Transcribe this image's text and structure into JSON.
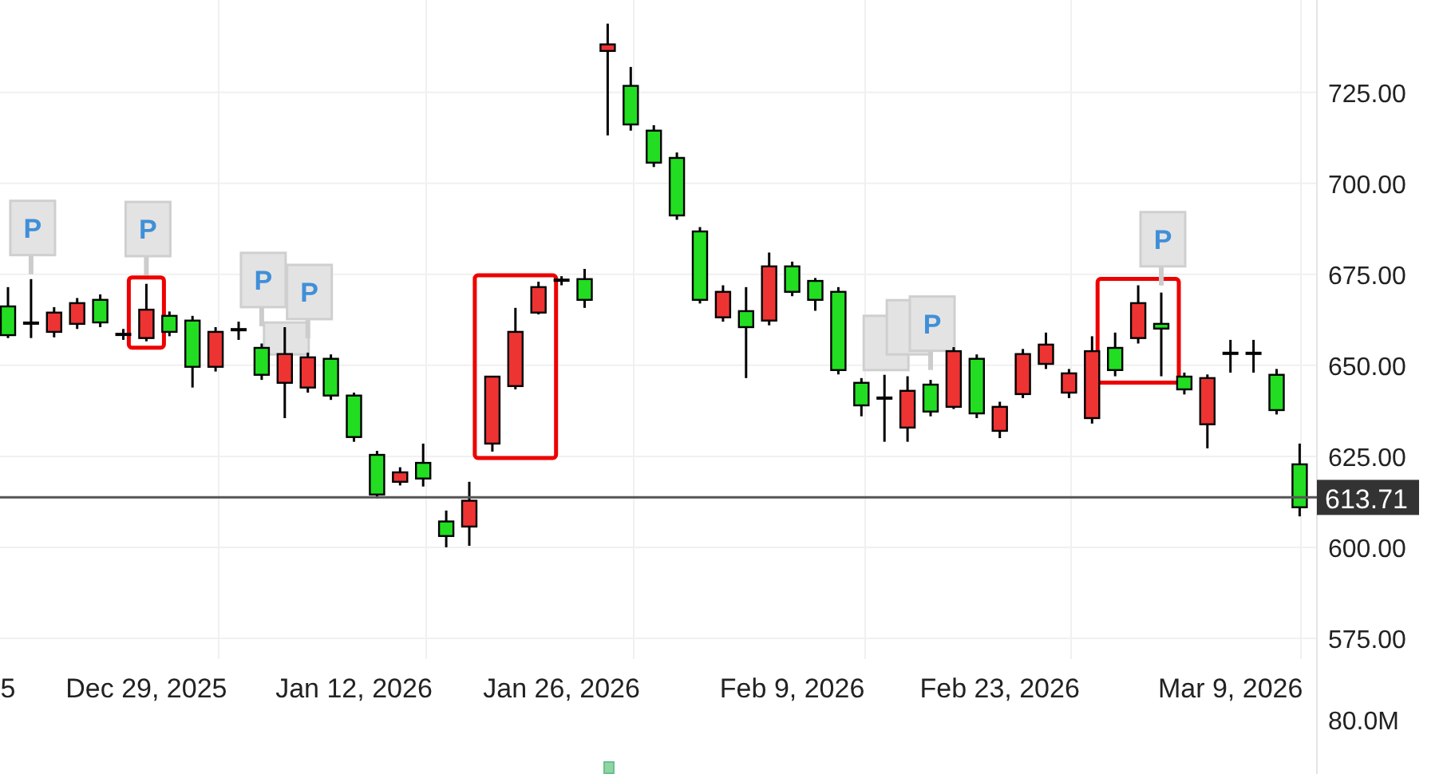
{
  "chart": {
    "chart_data": {
      "type": "candlestick",
      "categories": [
        "5",
        null,
        null,
        null,
        null,
        null,
        "Dec 29, 2025",
        null,
        null,
        null,
        null,
        null,
        null,
        null,
        null,
        "Jan 12, 2026",
        null,
        null,
        null,
        null,
        null,
        null,
        null,
        null,
        "Jan 26, 2026",
        null,
        null,
        null,
        null,
        null,
        null,
        null,
        null,
        null,
        "Feb 9, 2026",
        null,
        null,
        null,
        null,
        null,
        null,
        null,
        null,
        "Feb 23, 2026",
        null,
        null,
        null,
        null,
        null,
        null,
        null,
        null,
        null,
        "Mar 9, 2026",
        null,
        null,
        null
      ],
      "ohlc": [
        [
          658.3,
          671.5,
          657.5,
          666.2
        ],
        [
          661.4,
          673.7,
          657.5,
          661.6
        ],
        [
          664.5,
          666,
          657.7,
          659.2
        ],
        [
          667.1,
          668.5,
          660,
          661.4
        ],
        [
          661.8,
          669.5,
          660.5,
          668
        ],
        [
          658.3,
          660,
          657,
          658.5
        ],
        [
          665.3,
          672.4,
          656.6,
          657.5
        ],
        [
          659.2,
          664.8,
          658,
          663.6
        ],
        [
          649.6,
          663.6,
          643.9,
          662.3
        ],
        [
          659.2,
          660.5,
          648.3,
          649.6
        ],
        [
          659.6,
          662,
          657,
          659.8
        ],
        [
          647.4,
          656,
          646,
          654.8
        ],
        [
          653.1,
          660.5,
          635.5,
          645.2
        ],
        [
          652.2,
          653.5,
          642.5,
          643.9
        ],
        [
          641.7,
          653,
          640.5,
          651.8
        ],
        [
          630.3,
          642.5,
          629,
          641.7
        ],
        [
          614.5,
          626.5,
          613.5,
          625.4
        ],
        [
          620.6,
          622,
          617,
          618
        ],
        [
          618.9,
          628.5,
          616.7,
          623.2
        ],
        [
          603.1,
          610.1,
          600,
          607.1
        ],
        [
          612.8,
          618,
          600.4,
          605.7
        ],
        [
          646.9,
          647,
          626.3,
          628.5
        ],
        [
          659.2,
          665.8,
          643.4,
          644.3
        ],
        [
          671.5,
          673,
          664,
          664.5
        ],
        [
          673.2,
          674.5,
          672,
          673.4
        ],
        [
          668,
          676.5,
          665.8,
          673.7
        ],
        [
          738.2,
          743.9,
          713.2,
          736.4
        ],
        [
          716.2,
          732,
          714.5,
          726.8
        ],
        [
          705.7,
          716,
          704.5,
          714.5
        ],
        [
          691.2,
          708.5,
          690,
          707
        ],
        [
          668,
          688,
          667,
          686.8
        ],
        [
          670.2,
          672,
          662,
          663.2
        ],
        [
          660.5,
          671.5,
          646.5,
          664.9
        ],
        [
          677.2,
          681,
          661,
          662.3
        ],
        [
          670.2,
          678.5,
          669,
          677.2
        ],
        [
          668,
          674,
          665,
          673.2
        ],
        [
          648.7,
          671.5,
          647.5,
          670.2
        ],
        [
          639,
          646.5,
          636,
          645.2
        ],
        [
          640.8,
          647.4,
          629,
          641
        ],
        [
          643,
          647,
          629,
          632.9
        ],
        [
          637.3,
          646,
          636,
          644.7
        ],
        [
          653.9,
          655,
          638,
          638.6
        ],
        [
          636.8,
          653,
          635.5,
          651.8
        ],
        [
          638.6,
          640,
          630,
          632
        ],
        [
          653.1,
          654.5,
          641,
          642.1
        ],
        [
          655.7,
          659,
          649,
          650.4
        ],
        [
          647.8,
          649,
          641,
          642.5
        ],
        [
          653.9,
          658,
          634,
          635.5
        ],
        [
          648.7,
          659,
          647,
          654.8
        ],
        [
          667.1,
          672,
          656,
          657.5
        ],
        [
          660.1,
          670,
          647,
          661.4
        ],
        [
          643.4,
          648,
          642,
          646.9
        ],
        [
          646.5,
          647.5,
          627.2,
          633.8
        ],
        [
          653.1,
          657,
          648,
          653.3
        ],
        [
          653.1,
          657,
          648,
          653.3
        ],
        [
          637.7,
          649,
          636.5,
          647.4
        ],
        [
          611,
          628.5,
          608.5,
          622.8
        ]
      ],
      "ylim": [
        537.7,
        750.4
      ],
      "yticks": [
        {
          "value": 725,
          "label": "725.00"
        },
        {
          "value": 700,
          "label": "700.00"
        },
        {
          "value": 675,
          "label": "675.00"
        },
        {
          "value": 650,
          "label": "650.00"
        },
        {
          "value": 625,
          "label": "625.00"
        },
        {
          "value": 600,
          "label": "600.00"
        },
        {
          "value": 575,
          "label": "575.00"
        }
      ],
      "grid": true,
      "ref_lines": [
        {
          "axis": "y",
          "value": 613.71,
          "label": "613.71"
        }
      ]
    },
    "markers": [
      {
        "label": "P"
      },
      {
        "label": "P"
      },
      {
        "label": "P"
      },
      {
        "label": "P"
      },
      {
        "label": "P"
      },
      {
        "label": "P"
      }
    ],
    "volume_scale": "80.0M"
  }
}
